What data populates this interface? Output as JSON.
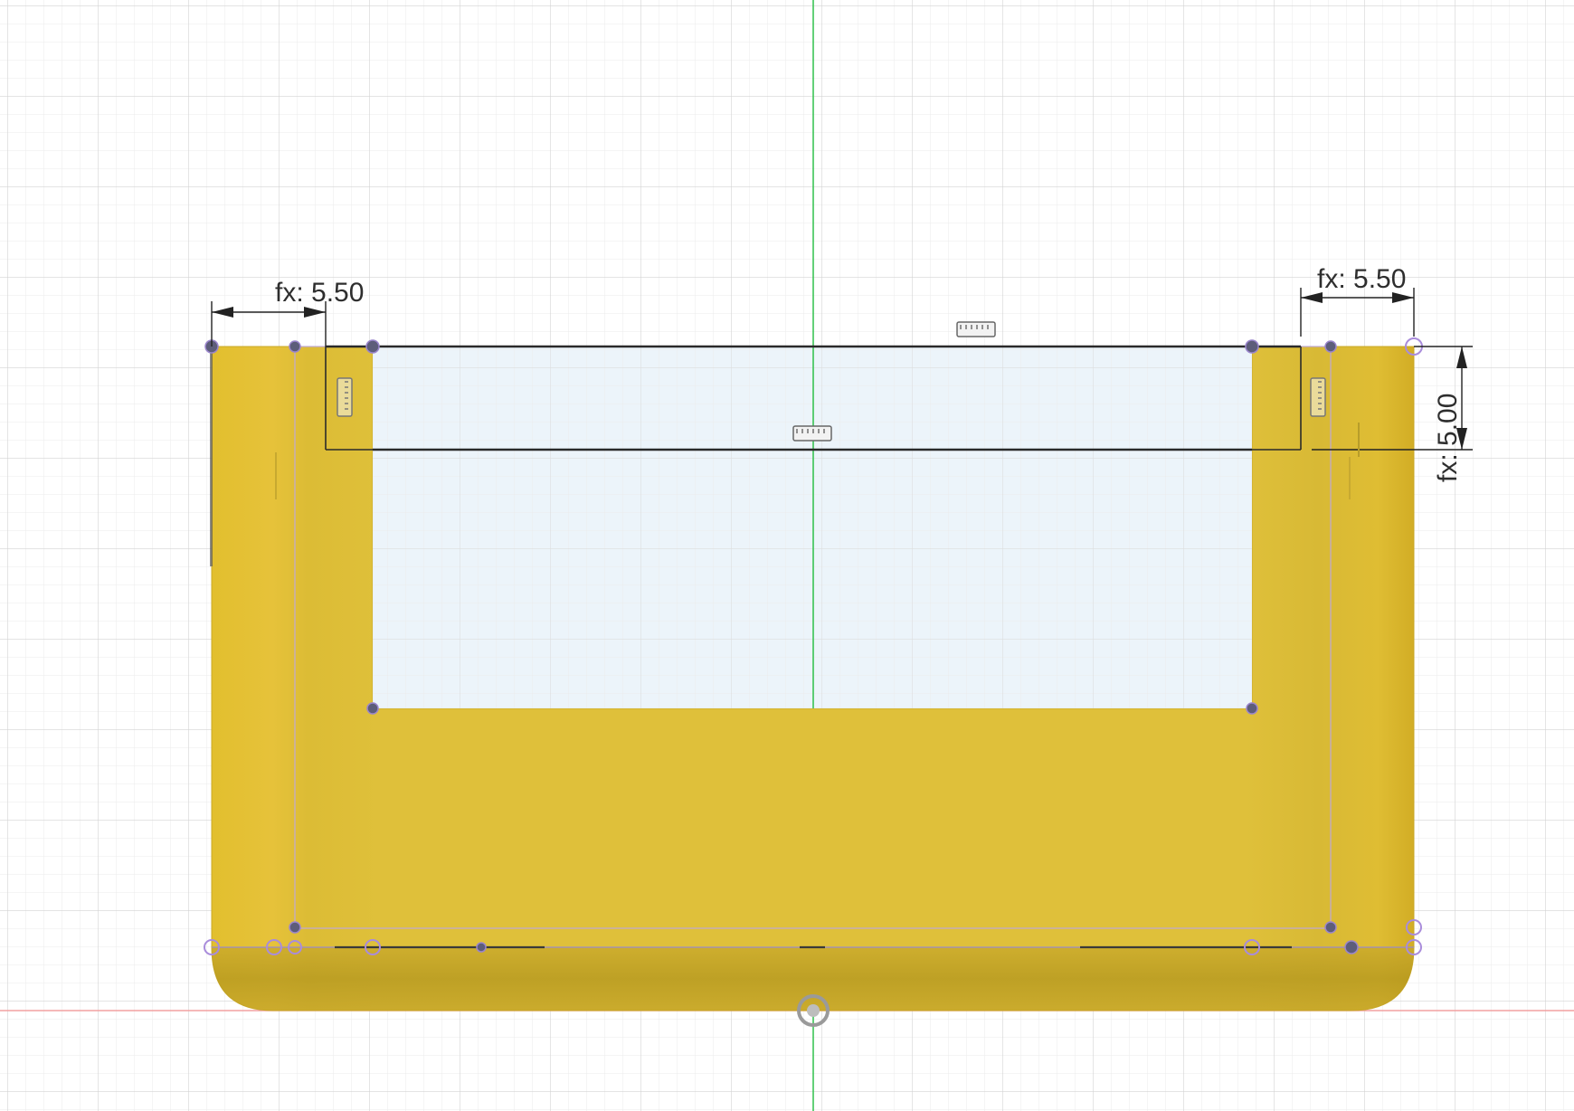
{
  "sketch": {
    "dimensions": {
      "top_left_width": {
        "label": "fx: 5.50",
        "value": 5.5
      },
      "top_right_width": {
        "label": "fx: 5.50",
        "value": 5.5
      },
      "right_height": {
        "label": "fx: 5.00",
        "value": 5.0
      }
    },
    "colors": {
      "body": "#e2c236",
      "body_shadow": "#b59820",
      "pocket_fill": "#eef5fa",
      "grid_minor": "#e8e8e8",
      "grid_major": "#d5d5d5",
      "axis_green": "#2db84a",
      "axis_red": "#f08a8a",
      "constraint_purple": "#a98cdb",
      "sketch_line": "#2a2a2a"
    }
  }
}
